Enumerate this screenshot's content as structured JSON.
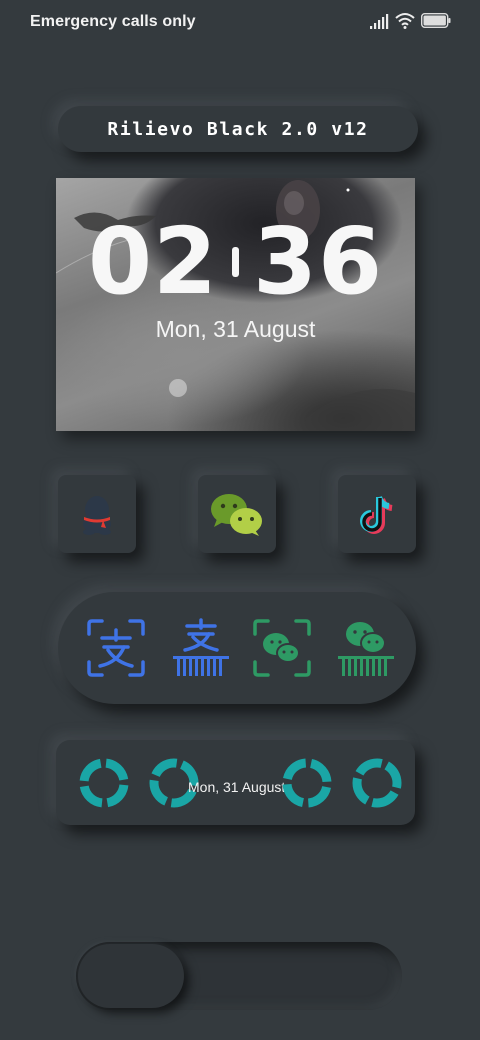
{
  "status_bar": {
    "carrier_text": "Emergency calls only",
    "icons": [
      "signal-icon",
      "wifi-icon",
      "battery-icon"
    ]
  },
  "theme": {
    "title": "Rilievo Black 2.0 v12"
  },
  "clock_widget": {
    "hours": "02",
    "minutes": "36",
    "date": "Mon, 31 August"
  },
  "apps": [
    {
      "name": "qq-icon"
    },
    {
      "name": "wechat-icon"
    },
    {
      "name": "tiktok-icon"
    }
  ],
  "payment_shortcuts": [
    {
      "name": "alipay-scan-icon"
    },
    {
      "name": "alipay-pay-code-icon"
    },
    {
      "name": "wechat-scan-icon"
    },
    {
      "name": "wechat-pay-code-icon"
    }
  ],
  "date_widget": {
    "date": "Mon, 31 August"
  },
  "colors": {
    "background": "#343a3e",
    "alipay_blue": "#3f73e6",
    "wechat_green": "#2e9a64",
    "ring_teal": "#1aa6a6"
  }
}
